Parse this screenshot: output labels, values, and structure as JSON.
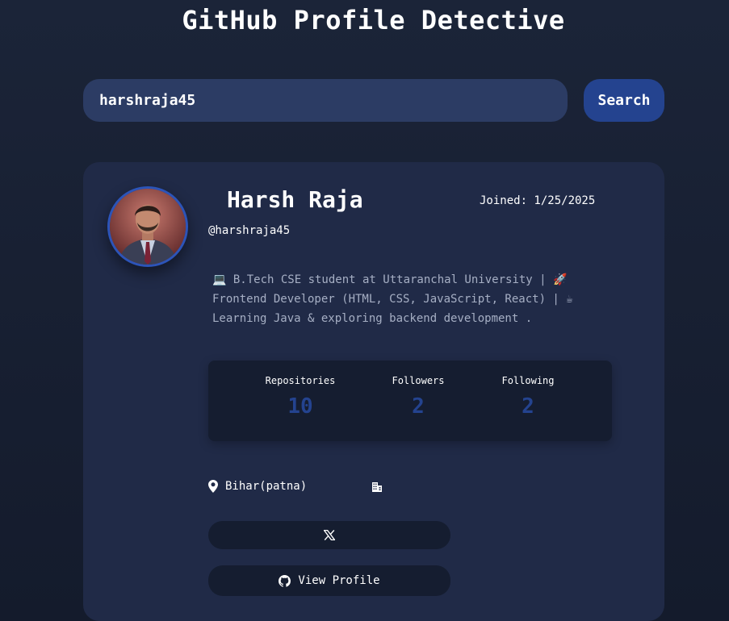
{
  "header": {
    "title": "GitHub Profile Detective"
  },
  "search": {
    "value": "harshraja45",
    "button_label": "Search"
  },
  "profile": {
    "name": "Harsh Raja",
    "username": "@harshraja45",
    "joined": "Joined: 1/25/2025",
    "bio": "💻 B.Tech CSE student at Uttaranchal University | 🚀 Frontend Developer (HTML, CSS, JavaScript, React) | ☕ Learning Java & exploring backend development .",
    "location": "Bihar(patna)",
    "view_profile_label": "View Profile"
  },
  "stats": {
    "repositories_label": "Repositories",
    "repositories_value": "10",
    "followers_label": "Followers",
    "followers_value": "2",
    "following_label": "Following",
    "following_value": "2"
  },
  "icons": {
    "location": "map-pin-icon",
    "company": "building-icon",
    "twitter": "x-logo-icon",
    "github": "github-icon"
  },
  "colors": {
    "background": "#171f32",
    "card": "#202a47",
    "panel": "#151d30",
    "accent": "#24438f",
    "input": "#2c3c64",
    "muted_text": "#a6afc4"
  }
}
